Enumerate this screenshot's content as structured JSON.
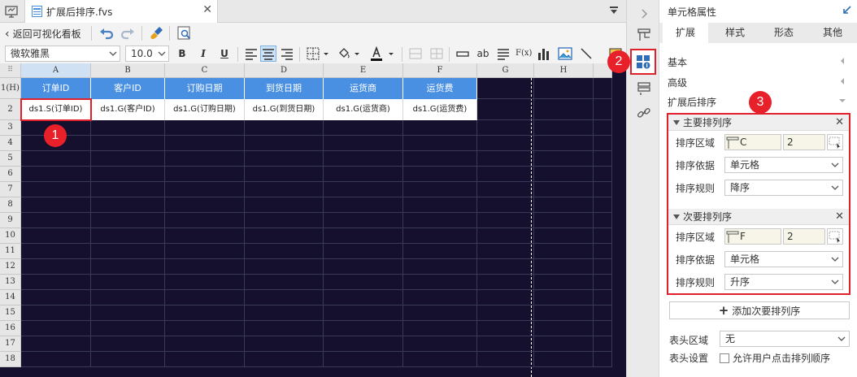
{
  "tab": {
    "title": "扩展后排序.fvs"
  },
  "toolbar": {
    "back_label": "返回可视化看板"
  },
  "format": {
    "font_family": "微软雅黑",
    "font_size": "10.0",
    "bold": "B",
    "italic": "I",
    "underline": "U",
    "text_ab": "ab",
    "formula": "F(x)"
  },
  "grid": {
    "corner": "⠿",
    "columns": [
      "A",
      "B",
      "C",
      "D",
      "E",
      "F",
      "G",
      "H"
    ],
    "row_labels": [
      "1(H)",
      "2",
      "3",
      "4",
      "5",
      "6",
      "7",
      "8",
      "9",
      "10",
      "11",
      "12",
      "13",
      "14",
      "15",
      "16",
      "17",
      "18"
    ],
    "header_row": [
      "订单ID",
      "客户ID",
      "订购日期",
      "到货日期",
      "运货商",
      "运货费"
    ],
    "data_row": [
      "ds1.S(订单ID)",
      "ds1.G(客户ID)",
      "ds1.G(订购日期)",
      "ds1.G(到货日期)",
      "ds1.G(运货商)",
      "ds1.G(运货费)"
    ]
  },
  "markers": {
    "m1": "1",
    "m2": "2",
    "m3": "3"
  },
  "panel": {
    "title": "单元格属性",
    "tabs": [
      "扩展",
      "样式",
      "形态",
      "其他"
    ],
    "sections": {
      "basic": "基本",
      "advanced": "高级",
      "sort_after_expand": "扩展后排序"
    },
    "primary": {
      "title": "主要排列序",
      "area_label": "排序区域",
      "area_col": "C",
      "area_num": "2",
      "basis_label": "排序依据",
      "basis_value": "单元格",
      "rule_label": "排序规则",
      "rule_value": "降序"
    },
    "secondary": {
      "title": "次要排列序",
      "area_label": "排序区域",
      "area_col": "F",
      "area_num": "2",
      "basis_label": "排序依据",
      "basis_value": "单元格",
      "rule_label": "排序规则",
      "rule_value": "升序"
    },
    "add_secondary": "添加次要排列序",
    "header_area_label": "表头区域",
    "header_area_value": "无",
    "header_setting_label": "表头设置",
    "allow_user_sort": "允许用户点击排列顺序"
  },
  "colors": {
    "accent": "#4a90e2",
    "highlight": "#e0202a",
    "grid_bg": "#15102e"
  }
}
